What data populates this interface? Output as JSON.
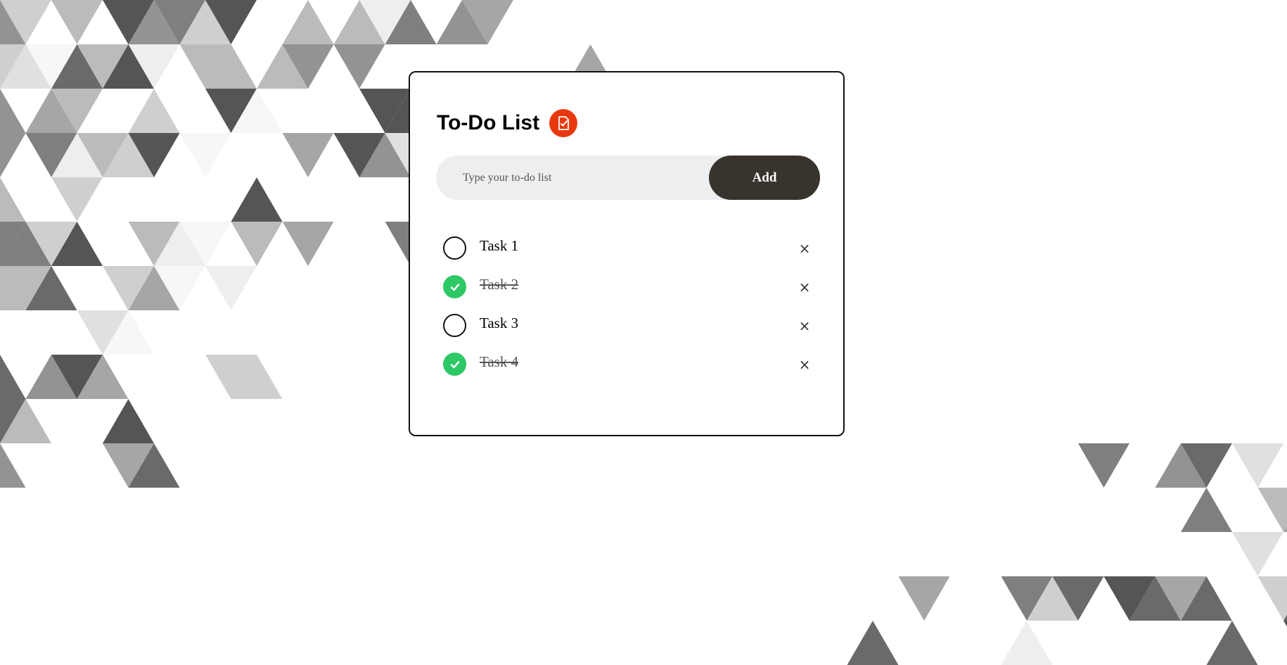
{
  "app": {
    "title": "To-Do List",
    "icon": "checklist-icon",
    "icon_color": "#e8390e"
  },
  "input": {
    "placeholder": "Type your to-do list",
    "value": ""
  },
  "add_button": {
    "label": "Add",
    "color": "#38342d"
  },
  "check_color": "#2ec866",
  "tasks": [
    {
      "text": "Task 1",
      "done": false
    },
    {
      "text": "Task 2",
      "done": true
    },
    {
      "text": "Task 3",
      "done": false
    },
    {
      "text": "Task 4",
      "done": true
    }
  ],
  "delete_glyph": "×"
}
